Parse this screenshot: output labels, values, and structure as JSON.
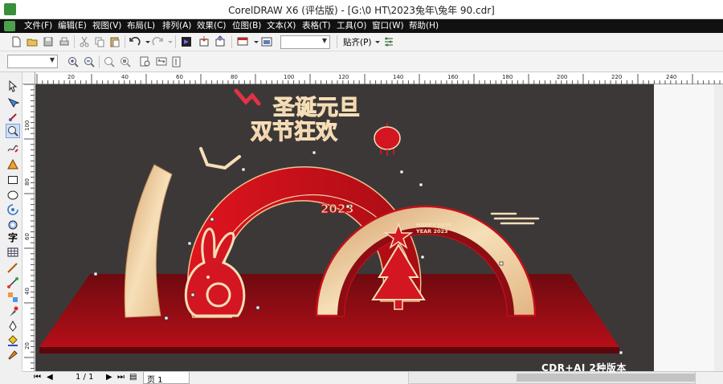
{
  "window": {
    "title": "CorelDRAW X6 (评估版) - [G:\\0 HT\\2023兔年\\兔年 90.cdr]"
  },
  "menu": [
    "文件(F)",
    "编辑(E)",
    "视图(V)",
    "布局(L)",
    "排列(A)",
    "效果(C)",
    "位图(B)",
    "文本(X)",
    "表格(T)",
    "工具(O)",
    "窗口(W)",
    "帮助(H)"
  ],
  "toolbar": {
    "snap_label": "贴齐(P)",
    "zoom_value": "",
    "font_value": ""
  },
  "ruler": {
    "h_ticks": [
      "20",
      "40",
      "60",
      "80",
      "100",
      "120",
      "140",
      "160",
      "180",
      "200",
      "220",
      "240"
    ],
    "v_ticks": [
      "100",
      "80",
      "60",
      "40",
      "20"
    ]
  },
  "artwork": {
    "headline_line1": "圣诞元旦",
    "headline_line2": "双节狂欢",
    "year_badge": "2023",
    "happy_new_year_1": "HAPPY NEW",
    "happy_new_year_2": "YEAR 2023",
    "colors": {
      "canvas_bg": "#3d3838",
      "red": "#c41019",
      "dark_red": "#8e0d14",
      "gold": "#e9c08d",
      "cream": "#f6dfb7"
    }
  },
  "status": {
    "page_counter": "1 / 1",
    "page_tab": "页 1"
  },
  "watermark": "CDR+AI 2种版本",
  "icons": [
    "app-logo-icon",
    "new-file-icon",
    "open-icon",
    "save-icon",
    "print-icon",
    "cut-icon",
    "copy-icon",
    "paste-icon",
    "undo-icon",
    "redo-icon",
    "import-icon",
    "export-icon",
    "zoom-in-icon",
    "zoom-out-icon",
    "pick-tool-icon",
    "shape-tool-icon",
    "crop-tool-icon",
    "zoom-tool-icon",
    "freehand-tool-icon",
    "rectangle-tool-icon",
    "ellipse-tool-icon",
    "text-tool-icon",
    "table-tool-icon",
    "fill-tool-icon"
  ]
}
